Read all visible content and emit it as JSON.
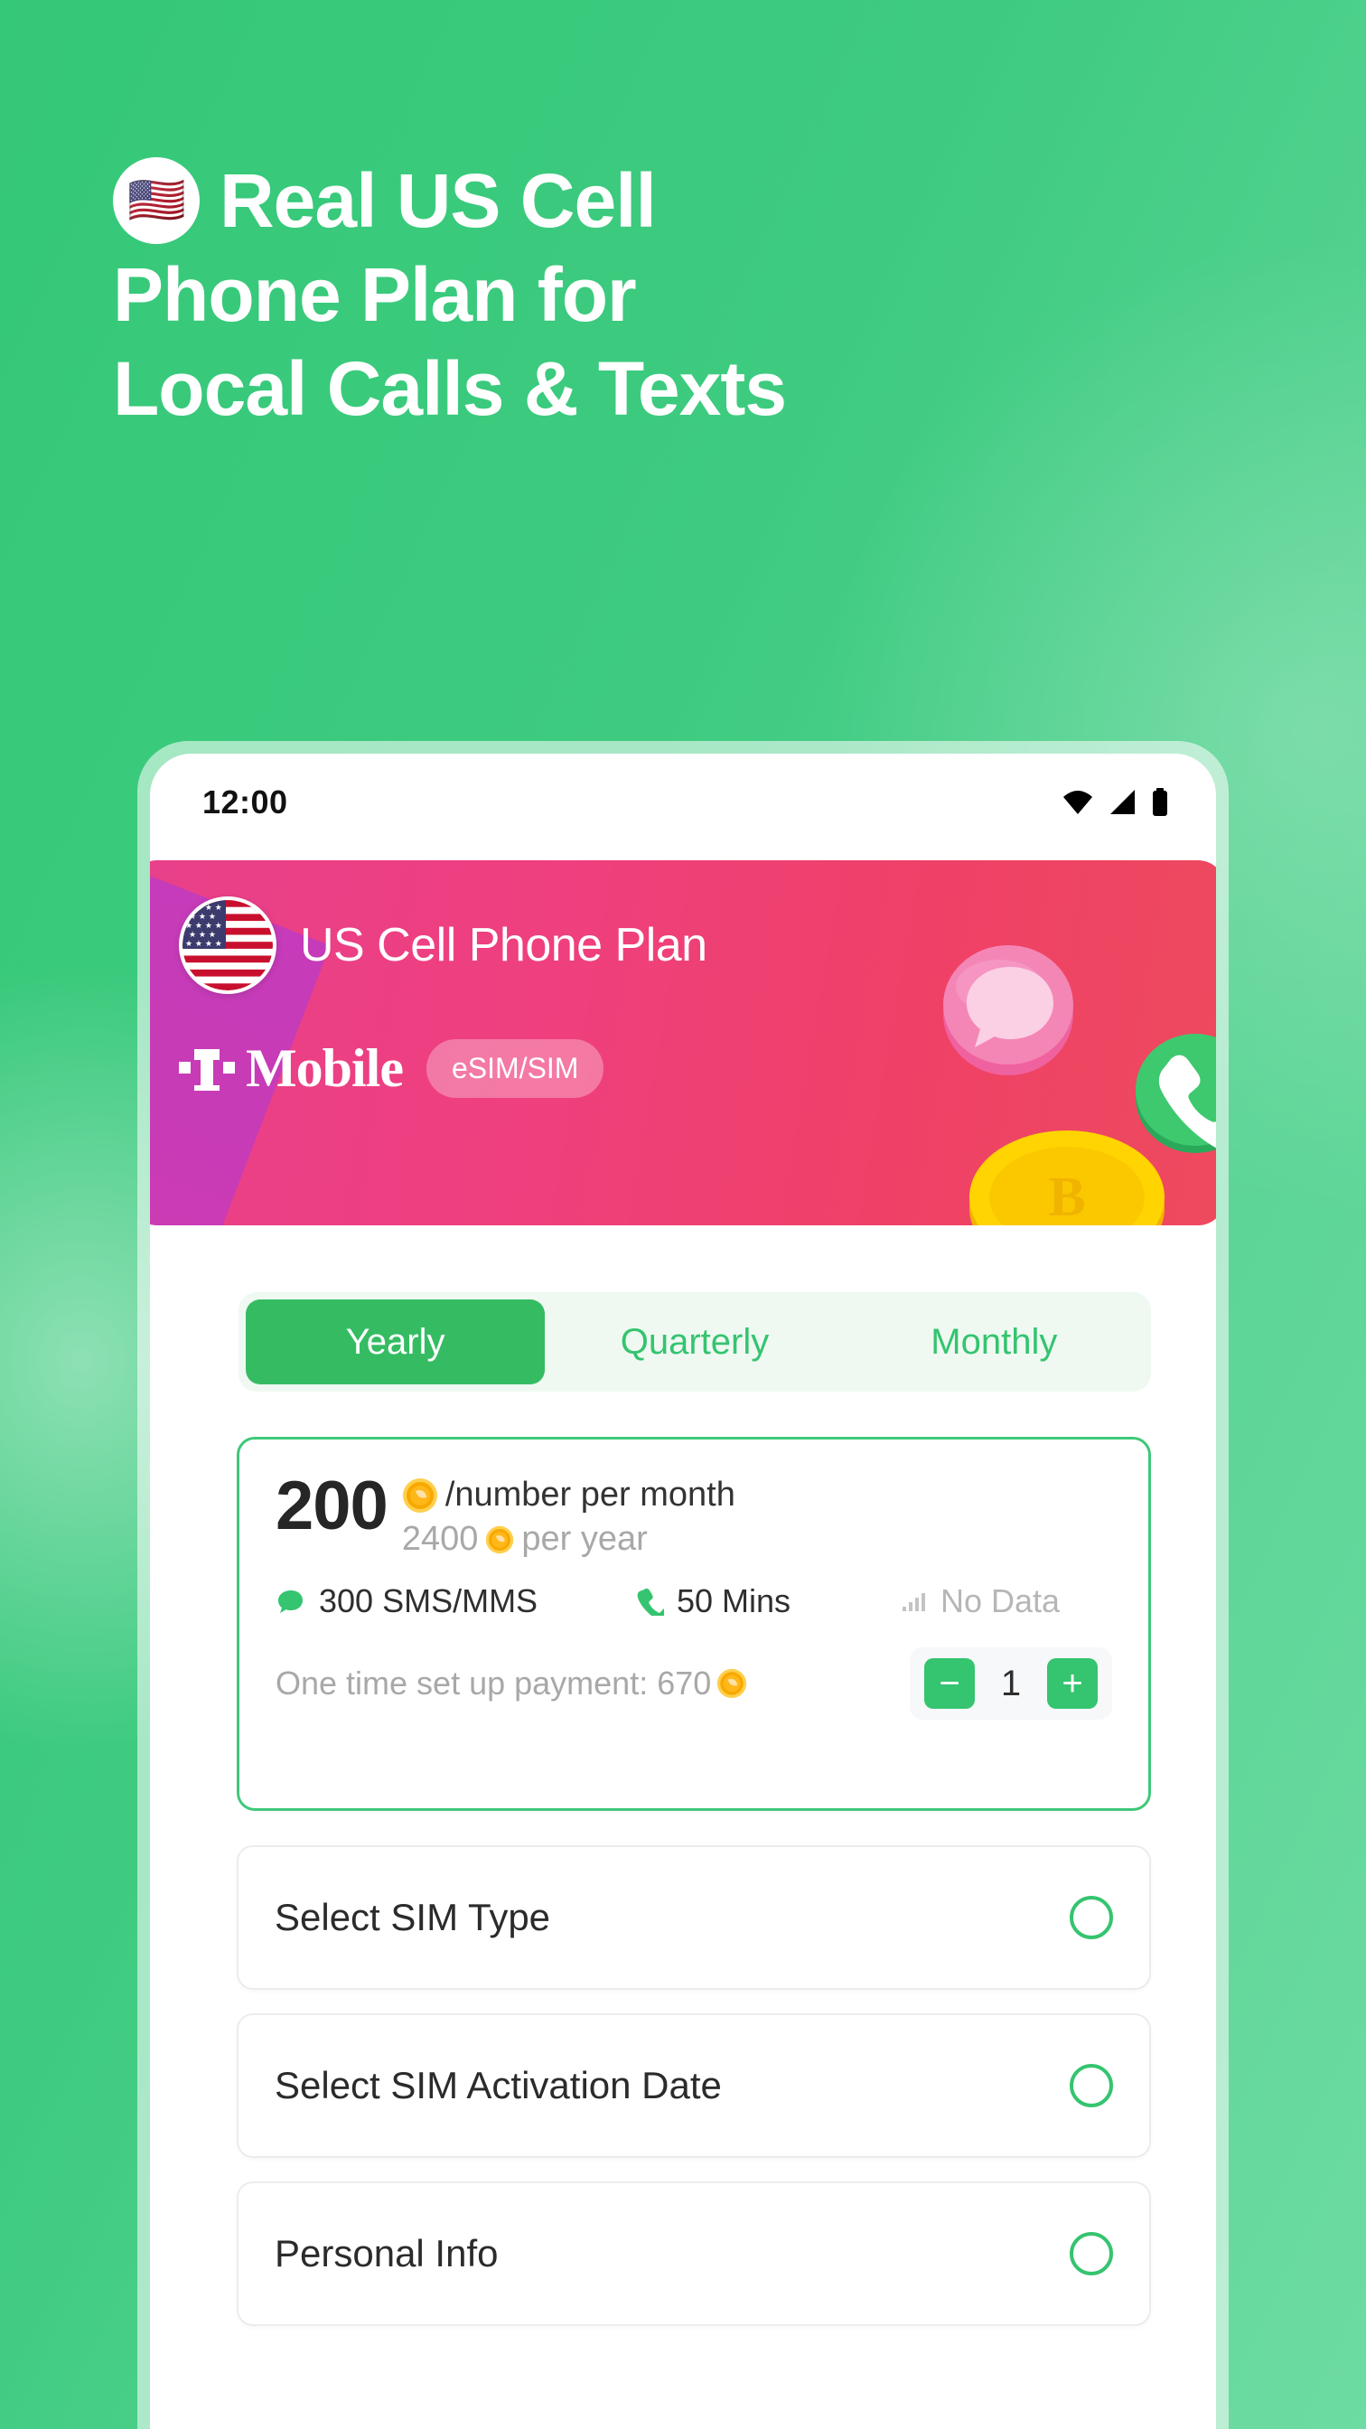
{
  "hero": {
    "flag_icon": "us-flag-emoji",
    "line1": "Real US Cell",
    "line2": "Phone Plan for",
    "line3": "Local Calls & Texts"
  },
  "statusbar": {
    "time": "12:00",
    "icons": [
      "wifi-icon",
      "cellular-signal-icon",
      "battery-icon"
    ]
  },
  "banner": {
    "flag_icon": "us-flag-circle-icon",
    "title": "US Cell Phone Plan",
    "carrier": "Mobile",
    "carrier_mark": "t-mobile-logo-icon",
    "sim_badge": "eSIM/SIM",
    "decorations": [
      "chat-bubble-icon",
      "phone-handset-icon",
      "gold-coin-icon"
    ],
    "colors": {
      "pink": "#ef3f7e",
      "purple": "#c53bb9"
    }
  },
  "tabs": {
    "items": [
      {
        "label": "Yearly",
        "active": true
      },
      {
        "label": "Quarterly",
        "active": false
      },
      {
        "label": "Monthly",
        "active": false
      }
    ]
  },
  "plan": {
    "price": "200",
    "price_unit": "/number per month",
    "price_sub_amount": "2400",
    "price_sub_unit": "per year",
    "coin_icon": "gold-coin-icon",
    "features": [
      {
        "icon": "sms-bubble-icon",
        "label": "300 SMS/MMS",
        "muted": false
      },
      {
        "icon": "phone-handset-icon",
        "label": "50 Mins",
        "muted": false
      },
      {
        "icon": "signal-bars-icon",
        "label": "No Data",
        "muted": true
      }
    ],
    "setup_label": "One time set up payment: 670",
    "stepper": {
      "minus_label": "−",
      "value": "1",
      "plus_label": "+"
    }
  },
  "options": {
    "rows": [
      {
        "label": "Select SIM Type",
        "indicator": "radio-circle-icon"
      },
      {
        "label": "Select SIM Activation Date",
        "indicator": "radio-circle-icon"
      },
      {
        "label": "Personal Info",
        "indicator": "radio-circle-icon"
      }
    ]
  },
  "theme": {
    "brand_green": "#35c46f",
    "bg_green": "#3ecb80",
    "muted_gray": "#a8a8a8"
  }
}
